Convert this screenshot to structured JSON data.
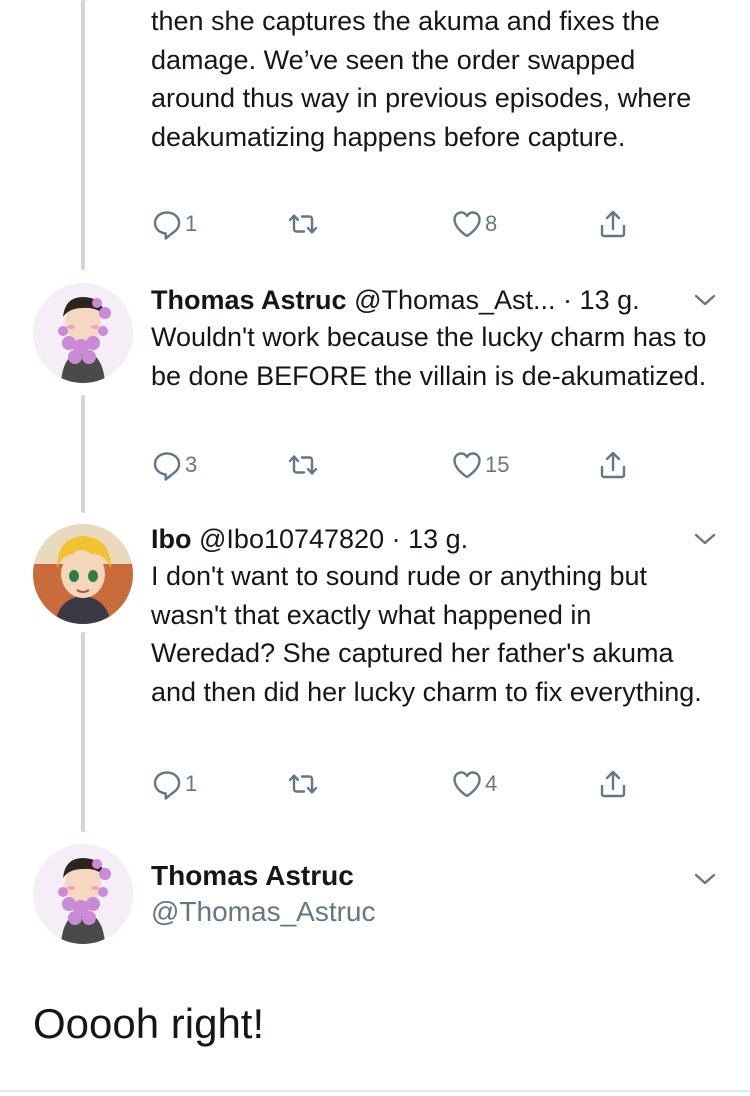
{
  "tweet1": {
    "body": "then she captures the akuma and fixes the damage. We’ve seen the order swapped around thus way in previous episodes, where deakumatizing happens before capture.",
    "reply_count": "1",
    "like_count": "8"
  },
  "tweet2": {
    "name": "Thomas Astruc",
    "handle": "@Thomas_Ast...",
    "sep": " · ",
    "time": "13 g.",
    "body": "Wouldn't work because the lucky charm has to be done BEFORE the villain is de-akumatized.",
    "reply_count": "3",
    "like_count": "15"
  },
  "tweet3": {
    "name": "Ibo",
    "handle": "@Ibo10747820",
    "sep": " · ",
    "time": "13 g.",
    "body": "I don't want to sound rude or anything but wasn't that exactly what happened in Weredad? She captured her father's akuma and then did her lucky charm to fix everything.",
    "reply_count": "1",
    "like_count": "4"
  },
  "main_tweet": {
    "name": "Thomas Astruc",
    "handle": "@Thomas_Astruc",
    "body": "Ooooh right!"
  },
  "colors": {
    "text": "#14171a",
    "secondary": "#657786",
    "thread_line": "#ccd6dd"
  },
  "icons": [
    "reply-icon",
    "retweet-icon",
    "like-icon",
    "share-icon",
    "chevron-down-icon"
  ]
}
